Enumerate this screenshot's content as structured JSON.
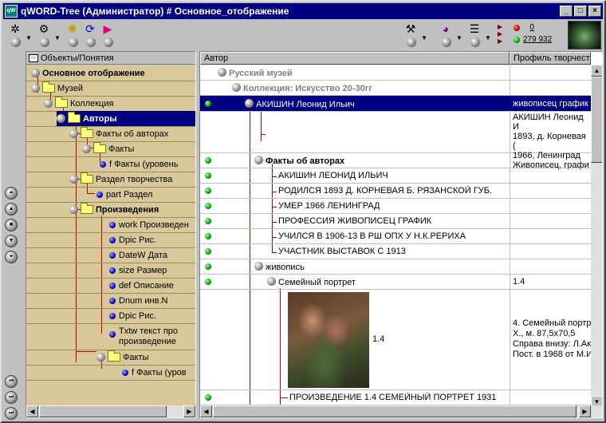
{
  "window": {
    "title": "qWORD-Tree (Администратор) # Основное_отображение",
    "icon_label": "qW",
    "controls": [
      "_",
      "□",
      "×"
    ]
  },
  "toolbar": {
    "counter_red": "0",
    "counter_green": "279 932"
  },
  "tree": {
    "header": "Объекты/Понятия",
    "nodes": [
      {
        "label": "Основное отображение",
        "bold": true
      },
      {
        "label": "Музей"
      },
      {
        "label": "Коллекция"
      },
      {
        "label": "Авторы",
        "bold": true,
        "selected": true
      },
      {
        "label": "Факты об авторах"
      },
      {
        "label": "Факты"
      },
      {
        "label": "f Факты (уровень"
      },
      {
        "label": "Раздел творчества"
      },
      {
        "label": "part Раздел"
      },
      {
        "label": "Произведения",
        "bold": true
      },
      {
        "label": "work Произведен"
      },
      {
        "label": "Dpic Рис."
      },
      {
        "label": "DateW Дата"
      },
      {
        "label": "size Размер"
      },
      {
        "label": "def Описание"
      },
      {
        "label": "Dnum инв.N"
      },
      {
        "label": "Dpic Рис."
      },
      {
        "label": "Txtw текст про"
      },
      {
        "label": "произведение"
      },
      {
        "label": "Факты"
      },
      {
        "label": "f Факты (уров"
      }
    ]
  },
  "grid": {
    "columns": [
      "Автор",
      "Профиль творчеств"
    ],
    "rows": {
      "museum": "Русский музей",
      "collection": "Коллекция: Искусство 20-30гг",
      "author": "АКИШИН Леонид Ильич",
      "author_profile": "живописец график",
      "bio_lines": [
        "АКИШИН Леонид И",
        "1893, д. Корневая (",
        "1966, Ленинград",
        "Живописец, графи"
      ],
      "facts_header": "Факты об авторах",
      "facts": [
        "АКИШИН ЛЕОНИД ИЛЬИЧ",
        "РОДИЛСЯ 1893 Д. КОРНЕВАЯ Б. РЯЗАНСКОЙ ГУБ.",
        "УМЕР 1966 ЛЕНИНГРАД",
        "ПРОФЕССИЯ ЖИВОПИСЕЦ ГРАФИК",
        "УЧИЛСЯ В 1906-13 В РШ ОПХ У Н.К.РЕРИХА",
        "УЧАСТНИК ВЫСТАВОК С 1913"
      ],
      "section": "живопись",
      "work": "Семейный портрет",
      "work_num": "1.4",
      "picture_num": "1.4",
      "work_desc_lines": [
        "4. Семейный портр",
        "Х., м. 87,5х70,5",
        "Справа внизу: Л.Ак",
        "Пост. в 1968 от М.И"
      ],
      "work_title_full": "ПРОИЗВЕДЕНИЕ 1.4 СЕМЕЙНЫЙ ПОРТРЕТ 1931"
    }
  }
}
